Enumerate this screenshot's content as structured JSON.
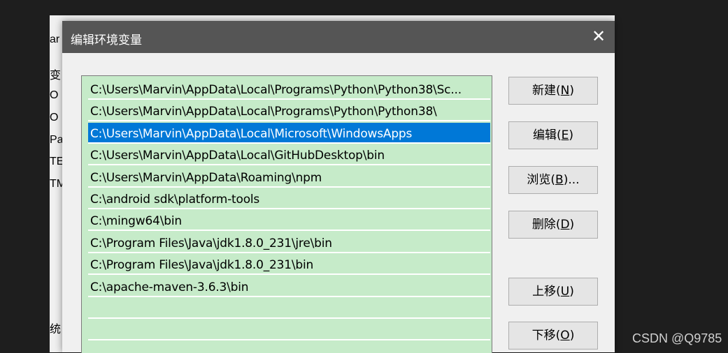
{
  "background_window": {
    "cut_labels": [
      "ar",
      "变",
      "O",
      "O",
      "Pa",
      "TE",
      "TM",
      "统"
    ]
  },
  "dialog": {
    "title": "编辑环境变量",
    "close_label": "✕"
  },
  "paths": [
    "C:\\Users\\Marvin\\AppData\\Local\\Programs\\Python\\Python38\\Sc...",
    "C:\\Users\\Marvin\\AppData\\Local\\Programs\\Python\\Python38\\",
    "C:\\Users\\Marvin\\AppData\\Local\\Microsoft\\WindowsApps",
    "C:\\Users\\Marvin\\AppData\\Local\\GitHubDesktop\\bin",
    "C:\\Users\\Marvin\\AppData\\Roaming\\npm",
    "C:\\android sdk\\platform-tools",
    "C:\\mingw64\\bin",
    "C:\\Program Files\\Java\\jdk1.8.0_231\\jre\\bin",
    "C:\\Program Files\\Java\\jdk1.8.0_231\\bin",
    "C:\\apache-maven-3.6.3\\bin",
    "",
    "",
    ""
  ],
  "selected_index": 2,
  "buttons": {
    "new": {
      "label": "新建",
      "key": "N"
    },
    "edit": {
      "label": "编辑",
      "key": "E"
    },
    "browse": {
      "label": "浏览",
      "key": "B",
      "suffix": "..."
    },
    "delete": {
      "label": "删除",
      "key": "D"
    },
    "move_up": {
      "label": "上移",
      "key": "U"
    },
    "move_down": {
      "label": "下移",
      "key": "O"
    }
  },
  "watermark": "CSDN @Q9785",
  "colors": {
    "list_bg": "#c6ebc9",
    "selection": "#0078d7",
    "titlebar": "#555555"
  }
}
